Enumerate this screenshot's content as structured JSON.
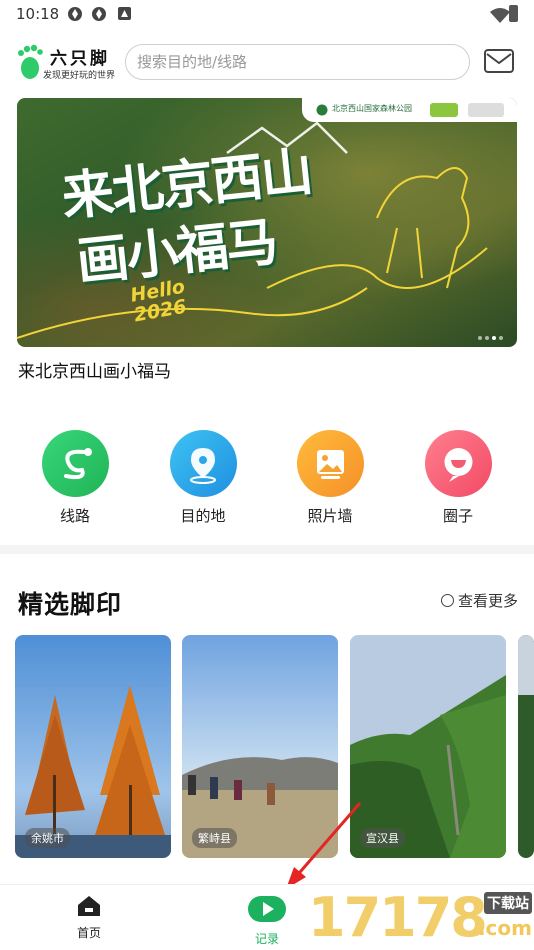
{
  "status_bar": {
    "time": "10:18"
  },
  "header": {
    "brand": "六只脚",
    "slogan": "发现更好玩的世界",
    "search_placeholder": "搜索目的地/线路"
  },
  "banner": {
    "title_line1": "来北京西山",
    "title_line2": "画小福马",
    "hello_line1": "Hello",
    "hello_line2": "2026",
    "caption": "来北京西山画小福马",
    "sponsor_text": "北京西山国家森林公园"
  },
  "quick_nav": [
    {
      "label": "线路",
      "icon": "route-icon",
      "color": "#2ecb6a"
    },
    {
      "label": "目的地",
      "icon": "location-pin-icon",
      "color": "#2fa8e8"
    },
    {
      "label": "照片墙",
      "icon": "photo-icon",
      "color": "#f8a12f"
    },
    {
      "label": "圈子",
      "icon": "chat-bubble-icon",
      "color": "#f5536e"
    }
  ],
  "featured": {
    "title": "精选脚印",
    "more_label": "查看更多",
    "cards": [
      {
        "tag": "余姚市"
      },
      {
        "tag": "繁峙县"
      },
      {
        "tag": "宣汉县"
      }
    ]
  },
  "bottom_nav": {
    "tabs": [
      {
        "label": "首页",
        "icon": "home-icon"
      },
      {
        "label": "记录",
        "icon": "play-record-icon"
      }
    ]
  },
  "watermark": {
    "digits": "17178",
    "site": "下载站",
    "com": ".com"
  },
  "colors": {
    "accent": "#1bb15f"
  }
}
